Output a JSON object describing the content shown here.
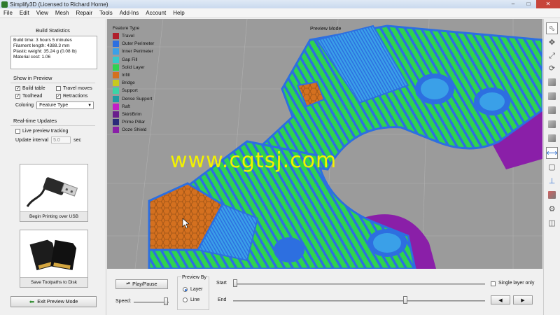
{
  "window": {
    "title": "Simplify3D (Licensed to Richard Horne)"
  },
  "menu": [
    "File",
    "Edit",
    "View",
    "Mesh",
    "Repair",
    "Tools",
    "Add-Ins",
    "Account",
    "Help"
  ],
  "build_stats": {
    "title": "Build Statistics",
    "lines": [
      "Build time: 3 hours 5 minutes",
      "Filament length: 4388.3 mm",
      "Plastic weight: 35.24 g (0.08 lb)",
      "Material cost: 1.06"
    ]
  },
  "show_in_preview": {
    "title": "Show in Preview",
    "build_table": "Build table",
    "travel_moves": "Travel moves",
    "toolhead": "Toolhead",
    "retractions": "Retractions",
    "coloring_label": "Coloring",
    "coloring_value": "Feature Type"
  },
  "realtime": {
    "title": "Real-time Updates",
    "live_preview": "Live preview tracking",
    "interval_label": "Update interval",
    "interval_value": "5.0",
    "interval_unit": "sec"
  },
  "cards": {
    "usb": "Begin Printing over USB",
    "sd": "Save Toolpaths to Disk"
  },
  "exit_button": "Exit Preview Mode",
  "viewport": {
    "preview_mode": "Preview Mode",
    "watermark": "www.cgtsj.com",
    "legend_title": "Feature Type",
    "legend": [
      {
        "label": "Travel",
        "color": "#b01e2a"
      },
      {
        "label": "Outer Perimeter",
        "color": "#2d6fe0"
      },
      {
        "label": "Inner Perimeter",
        "color": "#3aa0e8"
      },
      {
        "label": "Gap Fill",
        "color": "#35c9c9"
      },
      {
        "label": "Solid Layer",
        "color": "#2fd34f"
      },
      {
        "label": "Infill",
        "color": "#d4701f"
      },
      {
        "label": "Bridge",
        "color": "#c8c91f"
      },
      {
        "label": "Support",
        "color": "#3bd4a6"
      },
      {
        "label": "Dense Support",
        "color": "#1f9aa3"
      },
      {
        "label": "Raft",
        "color": "#c21ec6"
      },
      {
        "label": "Skirt/Brim",
        "color": "#6a1e8c"
      },
      {
        "label": "Prime Pillar",
        "color": "#2b2b7a"
      },
      {
        "label": "Ooze Shield",
        "color": "#8a1fa8"
      }
    ]
  },
  "controls": {
    "play_pause": "Play/Pause",
    "speed_label": "Speed:",
    "preview_by": "Preview By",
    "layer": "Layer",
    "line": "Line",
    "start_label": "Start",
    "end_label": "End",
    "single_layer": "Single layer only"
  }
}
